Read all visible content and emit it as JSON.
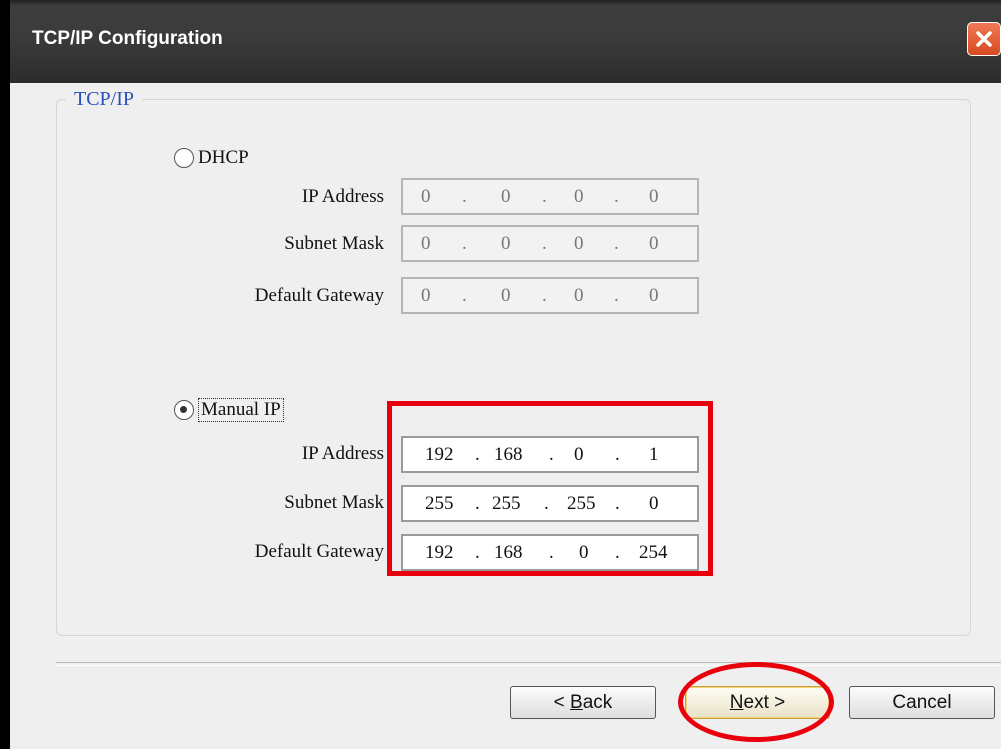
{
  "window": {
    "title": "TCP/IP Configuration"
  },
  "group": {
    "title": "TCP/IP"
  },
  "dhcp": {
    "label": "DHCP",
    "selected": false,
    "ip_address": {
      "label": "IP Address",
      "octets": [
        "0",
        "0",
        "0",
        "0"
      ]
    },
    "subnet_mask": {
      "label": "Subnet Mask",
      "octets": [
        "0",
        "0",
        "0",
        "0"
      ]
    },
    "default_gateway": {
      "label": "Default Gateway",
      "octets": [
        "0",
        "0",
        "0",
        "0"
      ]
    }
  },
  "manual": {
    "label": "Manual IP",
    "selected": true,
    "ip_address": {
      "label": "IP Address",
      "octets": [
        "192",
        "168",
        "0",
        "1"
      ]
    },
    "subnet_mask": {
      "label": "Subnet Mask",
      "octets": [
        "255",
        "255",
        "255",
        "0"
      ]
    },
    "default_gateway": {
      "label": "Default Gateway",
      "octets": [
        "192",
        "168",
        "0",
        "254"
      ]
    }
  },
  "buttons": {
    "back": {
      "label": "< Back",
      "mnemonic": "B"
    },
    "next": {
      "label": "Next >",
      "mnemonic": "N"
    },
    "cancel": {
      "label": "Cancel"
    }
  },
  "colors": {
    "highlight": "#e8000c",
    "group_title": "#2a4fbf"
  },
  "icons": {
    "close": "close-icon",
    "radio_unchecked": "radio-unchecked-icon",
    "radio_checked": "radio-checked-icon"
  }
}
